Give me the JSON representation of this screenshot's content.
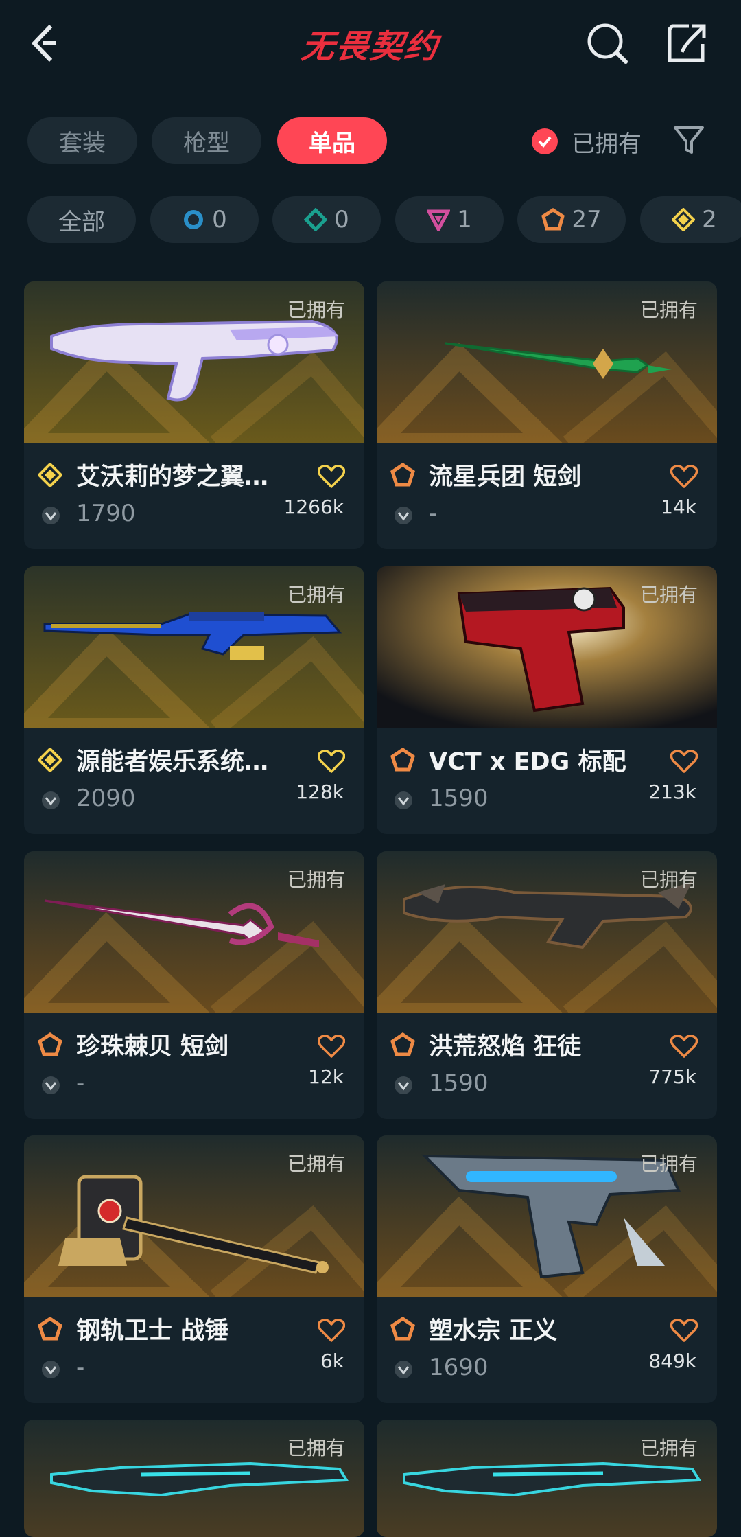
{
  "header": {
    "title": "无畏契约"
  },
  "tabs": [
    {
      "label": "套装",
      "active": false
    },
    {
      "label": "枪型",
      "active": false
    },
    {
      "label": "单品",
      "active": true
    }
  ],
  "owned_filter": {
    "label": "已拥有",
    "checked": true
  },
  "tiers": [
    {
      "label": "全部",
      "icon": ""
    },
    {
      "count": "0",
      "icon": "select-tier-icon",
      "color": "#2a8fc8"
    },
    {
      "count": "0",
      "icon": "deluxe-tier-icon",
      "color": "#1aa08f"
    },
    {
      "count": "1",
      "icon": "premium-tier-icon",
      "color": "#d24f9e"
    },
    {
      "count": "27",
      "icon": "exclusive-tier-icon",
      "color": "#ee8a45"
    },
    {
      "count": "2",
      "icon": "ultra-tier-icon",
      "color": "#f3d14c"
    }
  ],
  "owned_tag": "已拥有",
  "cards": [
    {
      "name": "艾沃莉的梦之翼…",
      "price": "1790",
      "likes": "1266k",
      "tier": "ultra",
      "bg": "olive"
    },
    {
      "name": "流星兵团 短剑",
      "price": "-",
      "likes": "14k",
      "tier": "exclusive",
      "bg": "brown"
    },
    {
      "name": "源能者娱乐系统…",
      "price": "2090",
      "likes": "128k",
      "tier": "ultra",
      "bg": "olive"
    },
    {
      "name": "VCT x EDG 标配",
      "price": "1590",
      "likes": "213k",
      "tier": "exclusive",
      "bg": "burst"
    },
    {
      "name": "珍珠棘贝 短剑",
      "price": "-",
      "likes": "12k",
      "tier": "exclusive",
      "bg": "brown"
    },
    {
      "name": "洪荒怒焰 狂徒",
      "price": "1590",
      "likes": "775k",
      "tier": "exclusive",
      "bg": "brown"
    },
    {
      "name": "钢轨卫士 战锤",
      "price": "-",
      "likes": "6k",
      "tier": "exclusive",
      "bg": "brown"
    },
    {
      "name": "塑水宗 正义",
      "price": "1690",
      "likes": "849k",
      "tier": "exclusive",
      "bg": "brown"
    }
  ],
  "colors": {
    "accent": "#ff4655",
    "ultra": "#f3d14c",
    "exclusive": "#ee8a45"
  }
}
